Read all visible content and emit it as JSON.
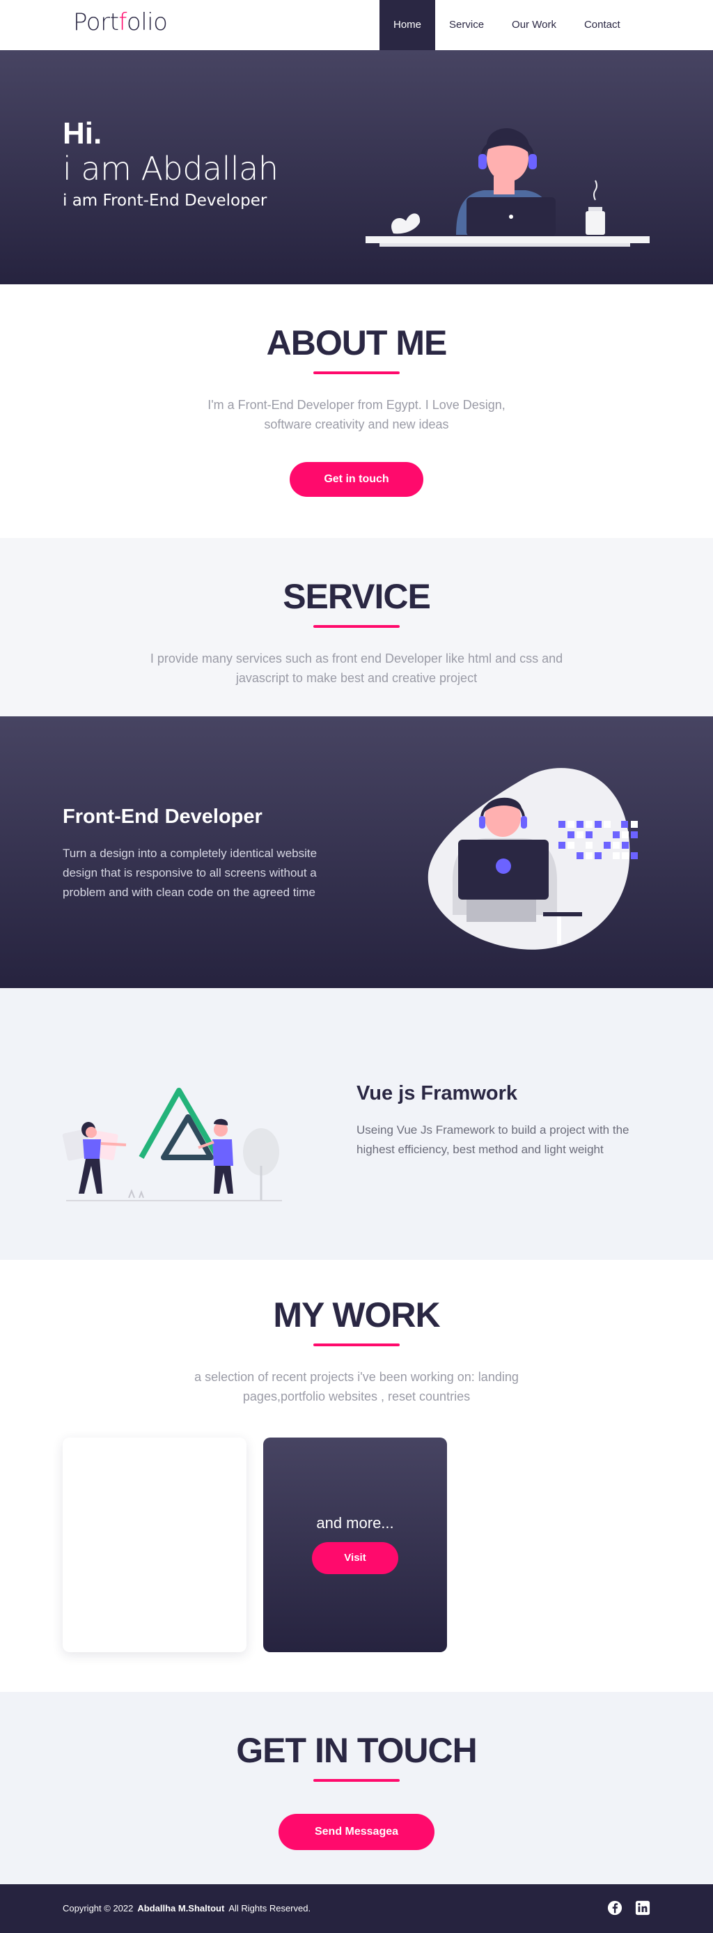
{
  "nav": {
    "logo_pre": "Port",
    "logo_accent": "f",
    "logo_post": "olio",
    "items": [
      {
        "label": "Home"
      },
      {
        "label": "Service"
      },
      {
        "label": "Our Work"
      },
      {
        "label": "Contact"
      }
    ]
  },
  "hero": {
    "hi": "Hi.",
    "name": "i am Abdallah",
    "role": "i am Front-End Developer"
  },
  "about": {
    "title": "ABOUT ME",
    "desc": "I'm a Front-End Developer from Egypt. I Love Design, software creativity and new ideas",
    "button": "Get in touch"
  },
  "service": {
    "title": "SERVICE",
    "desc": "I provide many services such as front end Developer like html and css and javascript to make best and creative project"
  },
  "frontend": {
    "title": "Front-End Developer",
    "desc": "Turn a design into a completely identical website design that is responsive to all screens without a problem and with clean code on the agreed time"
  },
  "vue": {
    "title": "Vue js Framwork",
    "desc": "Useing Vue Js Framework to build a project with the highest efficiency, best method and light weight"
  },
  "work": {
    "title": "MY WORK",
    "desc": "a selection of recent projects i've been working on: landing pages,portfolio websites , reset countries",
    "more": "and more...",
    "button": "Visit"
  },
  "contact": {
    "title": "GET IN TOUCH",
    "button": "Send Messagea"
  },
  "footer": {
    "copyright": "Copyright © 2022",
    "author": "Abdallha M.Shaltout",
    "rights": "All Rights Reserved."
  },
  "colors": {
    "accent": "#ff0a6c",
    "dark": "#2a2743",
    "purple": "#6c63ff"
  },
  "icons": [
    "facebook-icon",
    "linkedin-icon"
  ]
}
